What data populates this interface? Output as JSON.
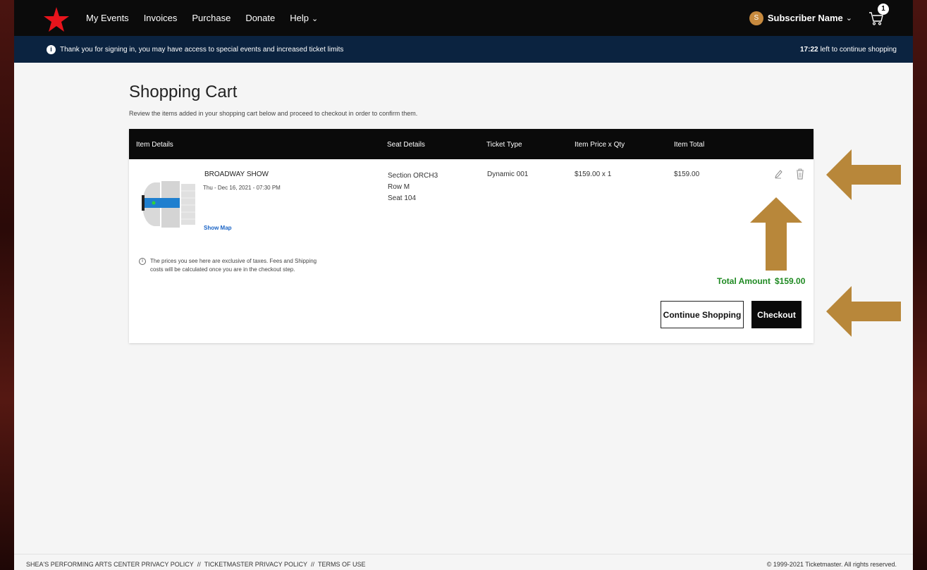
{
  "nav": {
    "links": [
      {
        "label": "My Events"
      },
      {
        "label": "Invoices"
      },
      {
        "label": "Purchase"
      },
      {
        "label": "Donate"
      },
      {
        "label": "Help"
      }
    ],
    "user": {
      "initial": "S",
      "name": "Subscriber Name"
    },
    "cart_count": "1",
    "icons": {
      "logo": "red-star-logo",
      "help_dropdown": "chevron-down-icon",
      "cart": "cart-icon"
    }
  },
  "info_bar": {
    "message": "Thank you for signing in, you may have access to special events and increased ticket limits",
    "timer": "17:22",
    "timer_suffix": "left to continue shopping"
  },
  "page": {
    "title": "Shopping Cart",
    "subtitle": "Review the items added in your shopping cart below and proceed to checkout in order to confirm them."
  },
  "cart": {
    "columns": [
      "Item Details",
      "Seat Details",
      "Ticket Type",
      "Item Price x Qty",
      "Item Total"
    ],
    "item": {
      "event_name": "BROADWAY SHOW",
      "event_date": "Thu - Dec 16, 2021 - 07:30 PM",
      "show_map_label": "Show Map",
      "section": "Section ORCH3",
      "row": "Row M",
      "seat": "Seat 104",
      "ticket_type": "Dynamic 001",
      "price_qty": "$159.00  x 1",
      "item_total": "$159.00"
    },
    "tax_note": "The prices you see here are exclusive of taxes. Fees and Shipping costs will be calculated once you are in the checkout step.",
    "total_label": "Total Amount",
    "total_value": "$159.00",
    "continue_label": "Continue Shopping",
    "checkout_label": "Checkout"
  },
  "footer": {
    "links": [
      "SHEA'S PERFORMING ARTS CENTER PRIVACY POLICY",
      "TICKETMASTER PRIVACY POLICY",
      "TERMS OF USE"
    ],
    "separator": "//",
    "copyright": "© 1999-2021 Ticketmaster. All rights reserved."
  },
  "colors": {
    "nav_bg": "#0b0b0b",
    "info_bg": "#0b2340",
    "total_green": "#1f8a22",
    "annotation_arrow": "#b8873a",
    "logo_red": "#e8141c"
  }
}
